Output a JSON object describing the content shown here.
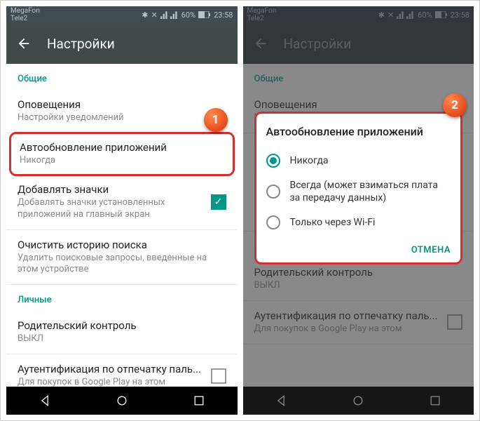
{
  "statusbar": {
    "carrier1": "MegaFon",
    "carrier2": "Tele2",
    "battery": "60%",
    "time": "23:58"
  },
  "appbar": {
    "title": "Настройки"
  },
  "sections": {
    "general": "Общие",
    "personal": "Личные"
  },
  "items": {
    "notifications": {
      "title": "Оповещения",
      "sub": "Настройки уведомлений"
    },
    "autoupdate": {
      "title": "Автообновление приложений",
      "sub": "Никогда"
    },
    "addicons": {
      "title": "Добавлять значки",
      "sub": "Добавлять значки установленных приложений на главный экран"
    },
    "clearhistory": {
      "title": "Очистить историю поиска",
      "sub": "Удалить поисковые запросы, введенные на этом устройстве"
    },
    "parental": {
      "title": "Родительский контроль",
      "sub": "ВЫКЛ"
    },
    "fingerprint": {
      "title": "Аутентификация по отпечатку паль...",
      "sub": "Для покупок в Google Play на этом"
    }
  },
  "dialog": {
    "title": "Автообновление приложений",
    "options": {
      "never": "Никогда",
      "always": "Всегда (может взиматься плата за передачу данных)",
      "wifi": "Только через Wi-Fi"
    },
    "cancel": "ОТМЕНА"
  },
  "badges": {
    "one": "1",
    "two": "2"
  }
}
